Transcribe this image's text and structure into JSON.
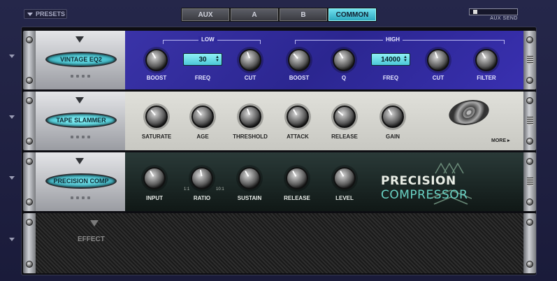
{
  "topbar": {
    "presets_label": "PRESETS",
    "tabs": [
      {
        "label": "AUX",
        "active": false
      },
      {
        "label": "A",
        "active": false
      },
      {
        "label": "B",
        "active": false
      },
      {
        "label": "COMMON",
        "active": true
      }
    ],
    "aux_send_label": "AUX SEND",
    "aux_send_level": 0.05
  },
  "units": {
    "eq": {
      "name": "VINTAGE EQ2",
      "group_low": "LOW",
      "group_high": "HIGH",
      "controls": {
        "low_boost": "BOOST",
        "low_freq": "FREQ",
        "low_cut": "CUT",
        "high_boost": "BOOST",
        "high_q": "Q",
        "high_freq": "FREQ",
        "high_cut": "CUT",
        "filter": "FILTER"
      },
      "low_freq_value": "30",
      "high_freq_value": "14000"
    },
    "tape": {
      "name": "TAPE SLAMMER",
      "controls": {
        "saturate": "SATURATE",
        "age": "AGE",
        "threshold": "THRESHOLD",
        "attack": "ATTACK",
        "release": "RELEASE",
        "gain": "GAIN"
      },
      "more_label": "MORE ▸"
    },
    "comp": {
      "name": "PRECISION COMP",
      "title_word1": "PRECISION",
      "title_word2": "COMPRESSOR",
      "controls": {
        "input": "INPUT",
        "ratio": "RATIO",
        "sustain": "SUSTAIN",
        "release": "RELEASE",
        "level": "LEVEL"
      },
      "ratio_min": "1:1",
      "ratio_max": "10:1"
    },
    "empty": {
      "label": "EFFECT"
    }
  },
  "colors": {
    "eq_panel": "#2b2690",
    "active_tab": "#2ea9c0",
    "comp_accent": "#6ad2c4"
  }
}
